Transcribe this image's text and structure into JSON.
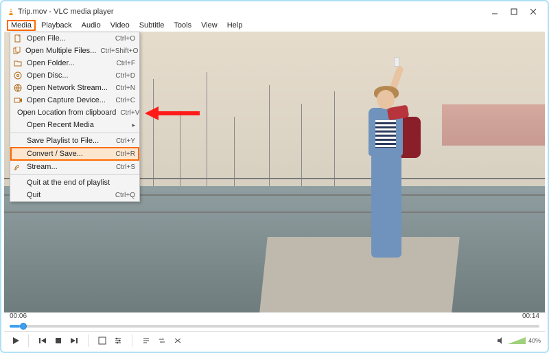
{
  "window": {
    "title": "Trip.mov - VLC media player"
  },
  "menubar": {
    "items": [
      "Media",
      "Playback",
      "Audio",
      "Video",
      "Subtitle",
      "Tools",
      "View",
      "Help"
    ],
    "active_index": 0
  },
  "media_menu": {
    "groups": [
      [
        {
          "icon": "file",
          "label": "Open File...",
          "shortcut": "Ctrl+O"
        },
        {
          "icon": "files",
          "label": "Open Multiple Files...",
          "shortcut": "Ctrl+Shift+O"
        },
        {
          "icon": "folder",
          "label": "Open Folder...",
          "shortcut": "Ctrl+F"
        },
        {
          "icon": "disc",
          "label": "Open Disc...",
          "shortcut": "Ctrl+D"
        },
        {
          "icon": "net",
          "label": "Open Network Stream...",
          "shortcut": "Ctrl+N"
        },
        {
          "icon": "cap",
          "label": "Open Capture Device...",
          "shortcut": "Ctrl+C"
        },
        {
          "icon": "",
          "label": "Open Location from clipboard",
          "shortcut": "Ctrl+V"
        },
        {
          "icon": "",
          "label": "Open Recent Media",
          "shortcut": "",
          "submenu": true
        }
      ],
      [
        {
          "icon": "",
          "label": "Save Playlist to File...",
          "shortcut": "Ctrl+Y"
        },
        {
          "icon": "",
          "label": "Convert / Save...",
          "shortcut": "Ctrl+R",
          "highlight": true
        },
        {
          "icon": "stream",
          "label": "Stream...",
          "shortcut": "Ctrl+S"
        }
      ],
      [
        {
          "icon": "",
          "label": "Quit at the end of playlist",
          "shortcut": ""
        },
        {
          "icon": "",
          "label": "Quit",
          "shortcut": "Ctrl+Q"
        }
      ]
    ]
  },
  "playback": {
    "current_time": "00:06",
    "total_time": "00:14",
    "volume_pct": "40%"
  }
}
